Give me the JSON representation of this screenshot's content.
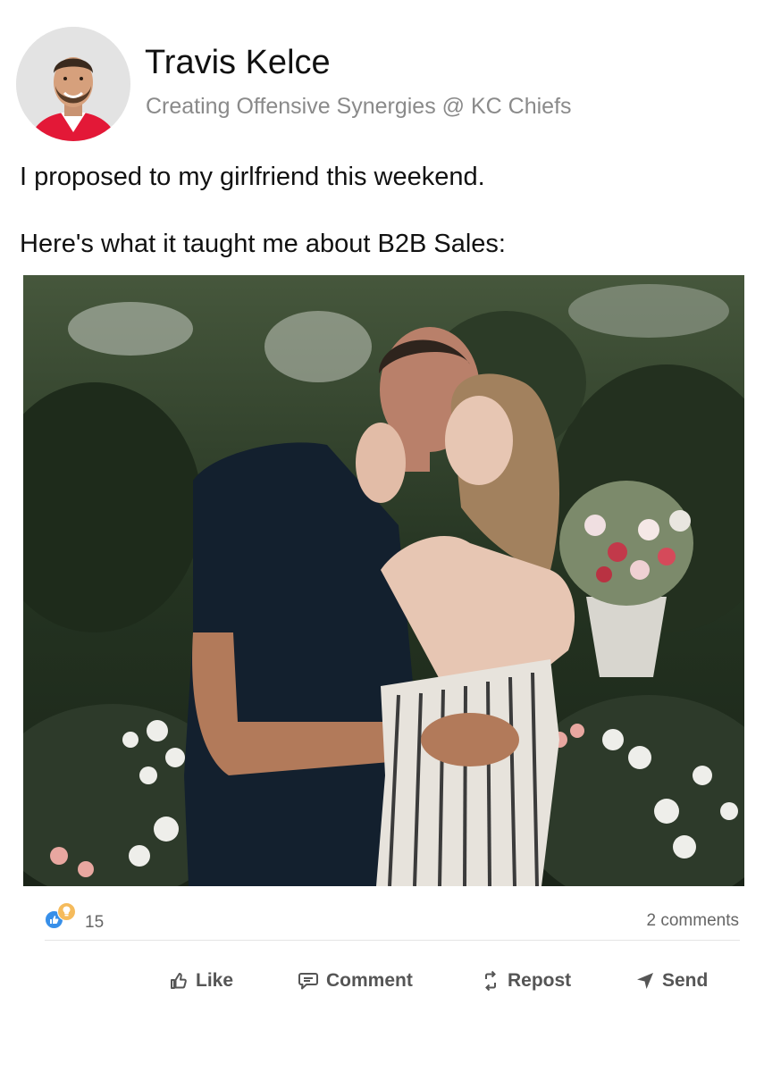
{
  "author": {
    "name": "Travis Kelce",
    "headline": "Creating Offensive Synergies @ KC Chiefs",
    "avatar_icon": "profile-photo"
  },
  "post": {
    "text_lines": [
      "I proposed to my girlfriend this weekend.",
      "Here's what it taught me about B2B Sales:"
    ],
    "image_icon": "engagement-photo"
  },
  "social": {
    "reaction_icons": [
      "like-reaction-icon",
      "insightful-reaction-icon"
    ],
    "reaction_count": "15",
    "comments": "2 comments"
  },
  "actions": {
    "like": "Like",
    "comment": "Comment",
    "repost": "Repost",
    "send": "Send"
  },
  "colors": {
    "author_name": "#111111",
    "headline": "#8a8a8a",
    "action_text": "#555555",
    "like_reaction": "#378fe9",
    "insight_reaction": "#f5bb5c",
    "avatar_bg": "#e3e3e3",
    "jersey_red": "#e31837"
  }
}
